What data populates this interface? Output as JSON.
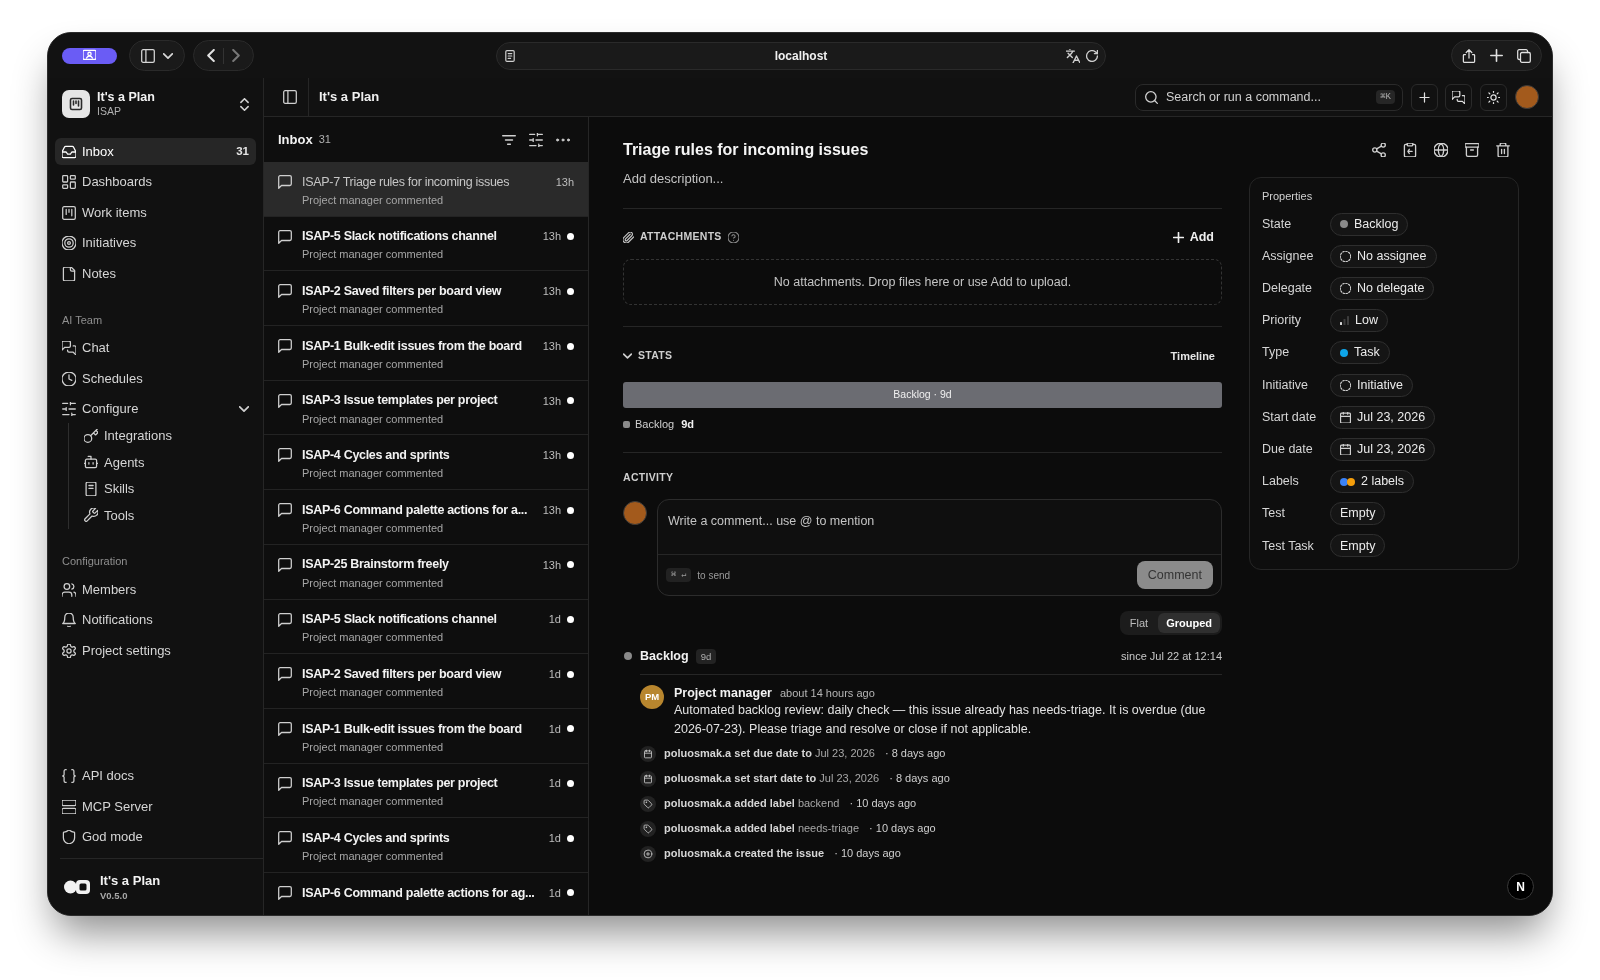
{
  "browser": {
    "url": "localhost"
  },
  "sidebar": {
    "workspace": {
      "name": "It's a Plan",
      "key": "ISAP"
    },
    "sections": [
      {
        "items": [
          {
            "label": "Inbox",
            "count": "31",
            "selected": true
          },
          {
            "label": "Dashboards",
            "selected": false
          },
          {
            "label": "Work items",
            "selected": false
          },
          {
            "label": "Initiatives",
            "selected": false
          },
          {
            "label": "Notes",
            "selected": false
          }
        ]
      },
      {
        "title": "AI Team",
        "items": [
          {
            "label": "Chat",
            "selected": false
          },
          {
            "label": "Schedules",
            "selected": false
          },
          {
            "label": "Configure",
            "selected": false,
            "expanded": true,
            "children": [
              {
                "label": "Integrations",
                "selected": false
              },
              {
                "label": "Agents",
                "selected": false
              },
              {
                "label": "Skills",
                "selected": false
              },
              {
                "label": "Tools",
                "selected": false
              }
            ]
          }
        ]
      },
      {
        "title": "Configuration",
        "items": [
          {
            "label": "Members",
            "selected": false
          },
          {
            "label": "Notifications",
            "selected": false
          },
          {
            "label": "Project settings",
            "selected": false
          }
        ]
      },
      {
        "items": [
          {
            "label": "API docs",
            "selected": false
          },
          {
            "label": "MCP Server",
            "selected": false
          },
          {
            "label": "God mode",
            "selected": false
          }
        ]
      }
    ],
    "footer": {
      "name": "It's a Plan",
      "version": "V0.5.0"
    }
  },
  "header": {
    "breadcrumb": "It's a Plan",
    "search": {
      "placeholder": "Search or run a command...",
      "shortcut": "⌘K"
    }
  },
  "inbox": {
    "title": "Inbox",
    "count": "31",
    "items": [
      {
        "title": "ISAP-7 Triage rules for incoming issues",
        "subtitle": "Project manager commented",
        "time": "13h",
        "unread": false,
        "selected": true
      },
      {
        "title": "ISAP-5 Slack notifications channel",
        "subtitle": "Project manager commented",
        "time": "13h",
        "unread": true,
        "selected": false
      },
      {
        "title": "ISAP-2 Saved filters per board view",
        "subtitle": "Project manager commented",
        "time": "13h",
        "unread": true,
        "selected": false
      },
      {
        "title": "ISAP-1 Bulk-edit issues from the board",
        "subtitle": "Project manager commented",
        "time": "13h",
        "unread": true,
        "selected": false
      },
      {
        "title": "ISAP-3 Issue templates per project",
        "subtitle": "Project manager commented",
        "time": "13h",
        "unread": true,
        "selected": false
      },
      {
        "title": "ISAP-4 Cycles and sprints",
        "subtitle": "Project manager commented",
        "time": "13h",
        "unread": true,
        "selected": false
      },
      {
        "title": "ISAP-6 Command palette actions for a...",
        "subtitle": "Project manager commented",
        "time": "13h",
        "unread": true,
        "selected": false
      },
      {
        "title": "ISAP-25 Brainstorm freely",
        "subtitle": "Project manager commented",
        "time": "13h",
        "unread": true,
        "selected": false
      },
      {
        "title": "ISAP-5 Slack notifications channel",
        "subtitle": "Project manager commented",
        "time": "1d",
        "unread": true,
        "selected": false
      },
      {
        "title": "ISAP-2 Saved filters per board view",
        "subtitle": "Project manager commented",
        "time": "1d",
        "unread": true,
        "selected": false
      },
      {
        "title": "ISAP-1 Bulk-edit issues from the board",
        "subtitle": "Project manager commented",
        "time": "1d",
        "unread": true,
        "selected": false
      },
      {
        "title": "ISAP-3 Issue templates per project",
        "subtitle": "Project manager commented",
        "time": "1d",
        "unread": true,
        "selected": false
      },
      {
        "title": "ISAP-4 Cycles and sprints",
        "subtitle": "Project manager commented",
        "time": "1d",
        "unread": true,
        "selected": false
      },
      {
        "title": "ISAP-6 Command palette actions for ag...",
        "time": "1d",
        "unread": true,
        "selected": false
      }
    ]
  },
  "issue": {
    "title": "Triage rules for incoming issues",
    "description": {
      "placeholder": "Add description..."
    },
    "attachments": {
      "heading": "ATTACHMENTS",
      "add_button": "Add",
      "empty_text": "No attachments. Drop files here or use Add to upload."
    },
    "stats": {
      "heading": "STATS",
      "expanded": true,
      "view": "Timeline",
      "segments": [
        {
          "label": "Backlog · 9d",
          "level": 1
        }
      ],
      "legend": [
        {
          "name": "Backlog",
          "value": "9d"
        }
      ]
    },
    "activity": {
      "heading": "ACTIVITY",
      "composer": {
        "placeholder": "Write a comment... use @ to mention",
        "shortcut": "⌘ ↵",
        "hint": "to send",
        "button": "Comment",
        "disabled": true
      },
      "view_modes": [
        {
          "label": "Flat",
          "selected": false
        },
        {
          "label": "Grouped",
          "selected": true
        }
      ],
      "groups": [
        {
          "name": "Backlog",
          "duration": "9d",
          "since": "since Jul 22 at 12:14",
          "entries": [
            {
              "kind": "comment",
              "initials": "PM",
              "author": "Project manager",
              "time": "about 14 hours ago",
              "text": "Automated backlog review: daily check — this issue already has needs-triage. It is overdue (due 2026-07-23). Please triage and resolve or close if not applicable."
            },
            {
              "kind": "date",
              "actor": "poluosmak.a",
              "action": "set due date to",
              "value": "Jul 23, 2026",
              "time": "· 8 days ago"
            },
            {
              "kind": "date",
              "actor": "poluosmak.a",
              "action": "set start date to",
              "value": "Jul 23, 2026",
              "time": "· 8 days ago"
            },
            {
              "kind": "label",
              "actor": "poluosmak.a",
              "action": "added label",
              "value": "backend",
              "time": "· 10 days ago"
            },
            {
              "kind": "label",
              "actor": "poluosmak.a",
              "action": "added label",
              "value": "needs-triage",
              "time": "· 10 days ago"
            },
            {
              "kind": "created",
              "actor": "poluosmak.a",
              "action": "created the issue",
              "time": "· 10 days ago"
            }
          ]
        }
      ]
    }
  },
  "properties": {
    "title": "Properties",
    "rows": [
      {
        "label": "State",
        "value": "Backlog",
        "kind": "status",
        "color": "#8a8a8a"
      },
      {
        "label": "Assignee",
        "value": "No assignee",
        "kind": "empty"
      },
      {
        "label": "Delegate",
        "value": "No delegate",
        "kind": "empty"
      },
      {
        "label": "Priority",
        "value": "Low",
        "kind": "priority"
      },
      {
        "label": "Type",
        "value": "Task",
        "kind": "status",
        "color": "#0ea5e9"
      },
      {
        "label": "Initiative",
        "value": "Initiative",
        "kind": "empty"
      },
      {
        "label": "Start date",
        "value": "Jul 23, 2026",
        "kind": "date"
      },
      {
        "label": "Due date",
        "value": "Jul 23, 2026",
        "kind": "date"
      },
      {
        "label": "Labels",
        "value": "2 labels",
        "kind": "labels",
        "dots": [
          {
            "color": "#3b82f6"
          },
          {
            "color": "#f59e0b"
          }
        ]
      },
      {
        "label": "Test",
        "value": "Empty",
        "kind": "plain"
      },
      {
        "label": "Test Task",
        "value": "Empty",
        "kind": "plain"
      }
    ]
  },
  "dev_badge": "N"
}
